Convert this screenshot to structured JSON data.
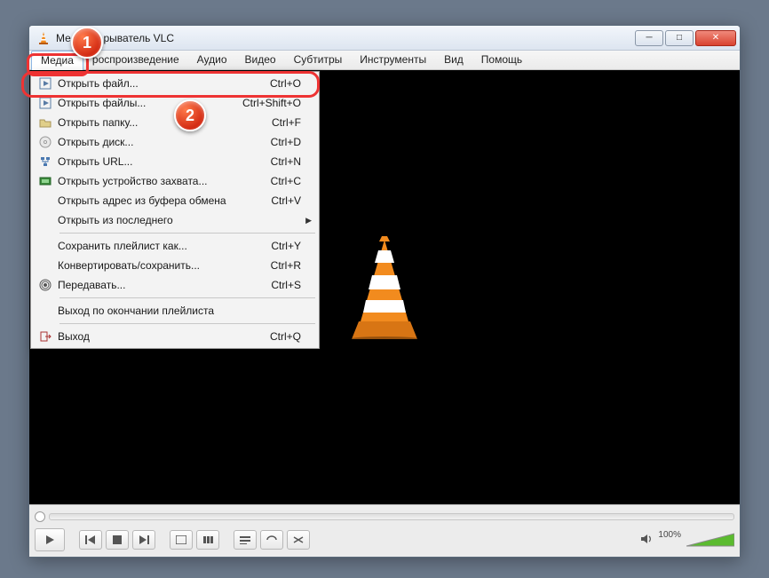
{
  "window": {
    "title_prefix": "Ме",
    "title_suffix": "рыватель VLC"
  },
  "menubar": {
    "items": [
      "Медиа",
      "роспроизведение",
      "Аудио",
      "Видео",
      "Субтитры",
      "Инструменты",
      "Вид",
      "Помощь"
    ]
  },
  "dropdown": {
    "groups": [
      [
        {
          "icon": "play-file",
          "label": "Открыть файл...",
          "shortcut": "Ctrl+O"
        },
        {
          "icon": "play-file",
          "label": "Открыть файлы...",
          "shortcut": "Ctrl+Shift+O"
        },
        {
          "icon": "folder",
          "label": "Открыть папку...",
          "shortcut": "Ctrl+F"
        },
        {
          "icon": "disc",
          "label": "Открыть диск...",
          "shortcut": "Ctrl+D"
        },
        {
          "icon": "network",
          "label": "Открыть URL...",
          "shortcut": "Ctrl+N"
        },
        {
          "icon": "capture",
          "label": "Открыть устройство захвата...",
          "shortcut": "Ctrl+C"
        },
        {
          "icon": "",
          "label": "Открыть адрес из буфера обмена",
          "shortcut": "Ctrl+V"
        },
        {
          "icon": "",
          "label": "Открыть из последнего",
          "shortcut": "",
          "submenu": true
        }
      ],
      [
        {
          "icon": "",
          "label": "Сохранить плейлист как...",
          "shortcut": "Ctrl+Y"
        },
        {
          "icon": "",
          "label": "Конвертировать/сохранить...",
          "shortcut": "Ctrl+R"
        },
        {
          "icon": "stream",
          "label": "Передавать...",
          "shortcut": "Ctrl+S"
        }
      ],
      [
        {
          "icon": "",
          "label": "Выход по окончании плейлиста",
          "shortcut": ""
        }
      ],
      [
        {
          "icon": "exit",
          "label": "Выход",
          "shortcut": "Ctrl+Q"
        }
      ]
    ]
  },
  "volume": {
    "label": "100%"
  },
  "badges": {
    "b1": "1",
    "b2": "2"
  }
}
